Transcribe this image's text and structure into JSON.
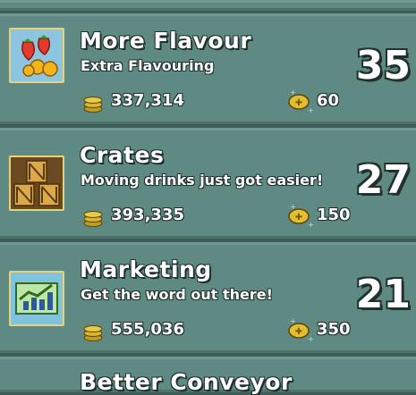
{
  "upgrades": [
    {
      "title": "More Flavour",
      "subtitle": "Extra Flavouring",
      "price": "337,314",
      "tokens": "60",
      "level": "35",
      "icon": "fruit-icon"
    },
    {
      "title": "Crates",
      "subtitle": "Moving drinks just got easier!",
      "price": "393,335",
      "tokens": "150",
      "level": "27",
      "icon": "crates-icon"
    },
    {
      "title": "Marketing",
      "subtitle": "Get the word out there!",
      "price": "555,036",
      "tokens": "350",
      "level": "21",
      "icon": "chart-icon"
    },
    {
      "title": "Better Conveyor",
      "icon": "conveyor-icon"
    }
  ],
  "colors": {
    "panel": "#5f8a84",
    "background": "#3f5d58",
    "frame": "#e7d27a",
    "coin": "#d8b832"
  }
}
